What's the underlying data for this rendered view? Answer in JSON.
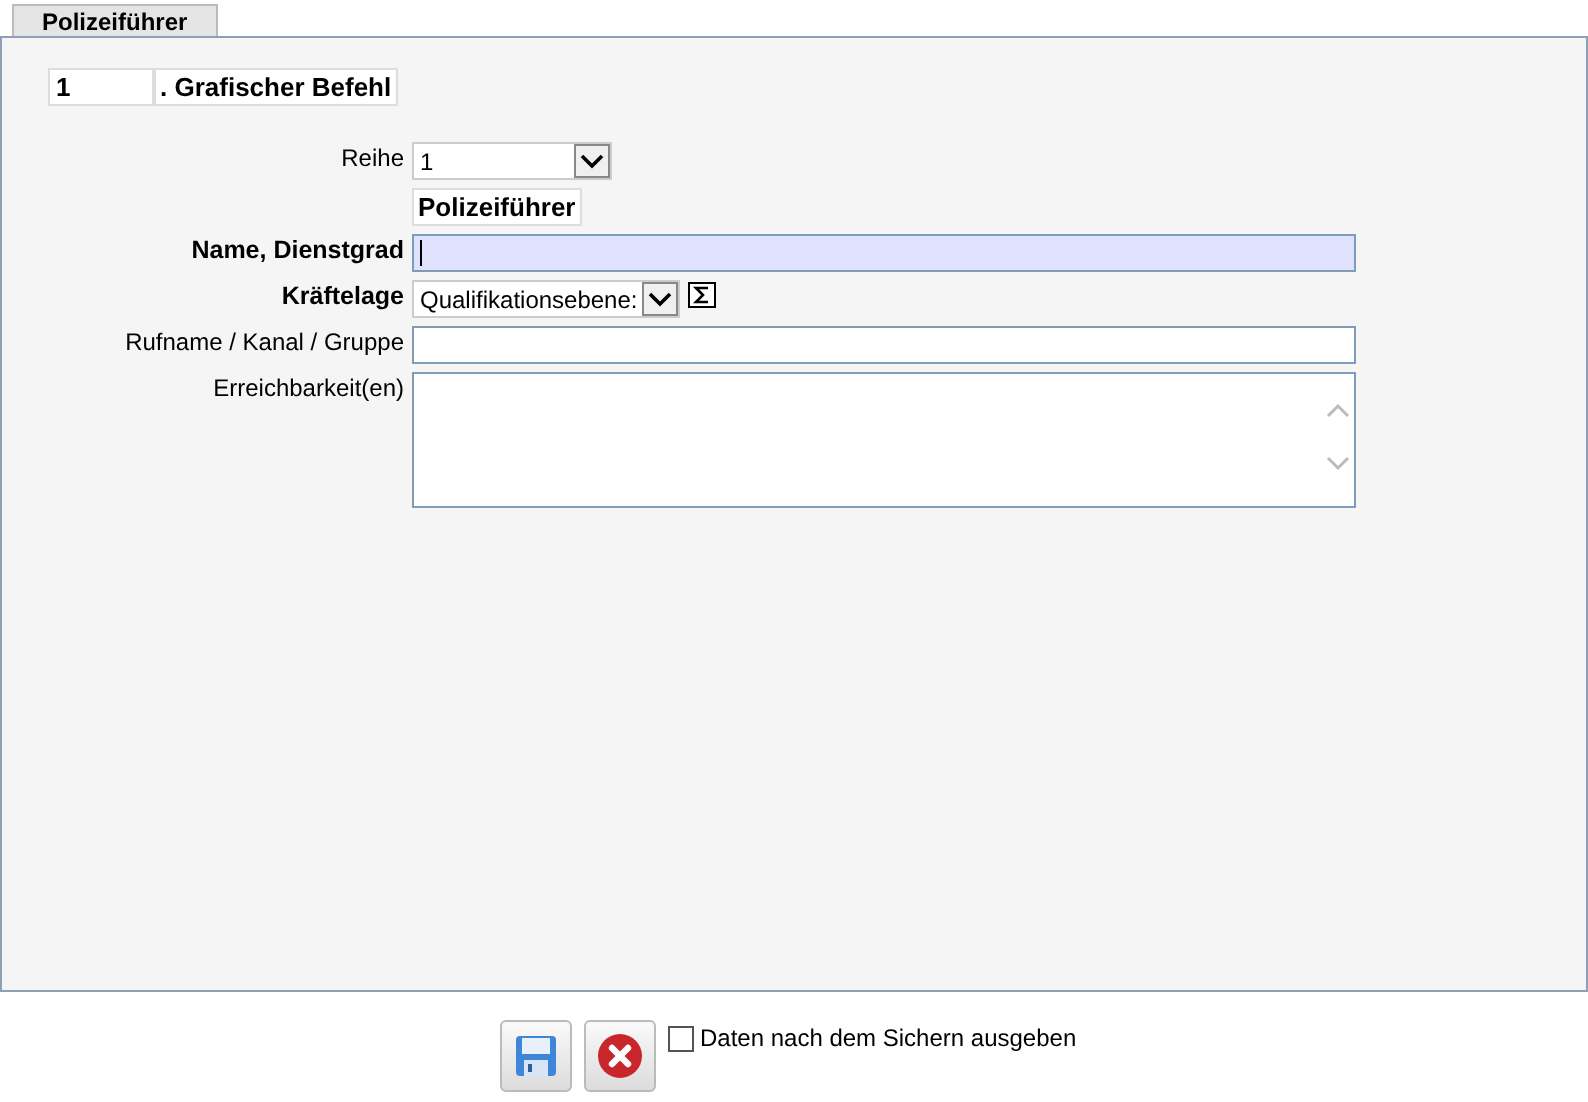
{
  "tabs": [
    {
      "label": "Polizeiführer",
      "selected": true
    }
  ],
  "header": {
    "number": "1",
    "title": ". Grafischer Befehl"
  },
  "rows": [
    {
      "kind": "select",
      "label": "Reihe",
      "bold": false,
      "value": "1"
    },
    {
      "kind": "caption",
      "value": "Polizeiführer"
    },
    {
      "kind": "text",
      "label": "Name, Dienstgrad",
      "bold": true,
      "focused": true
    },
    {
      "kind": "select-sum",
      "label": "Kräftelage",
      "bold": true,
      "value": "Qualifikationsebene:"
    },
    {
      "kind": "text",
      "label": "Rufname / Kanal / Gruppe",
      "bold": false,
      "focused": false
    },
    {
      "kind": "textarea",
      "label": "Erreichbarkeit(en)",
      "bold": false
    }
  ],
  "footer": {
    "checkbox": {
      "label": "Daten nach dem Sichern ausgeben",
      "checked": false
    }
  }
}
